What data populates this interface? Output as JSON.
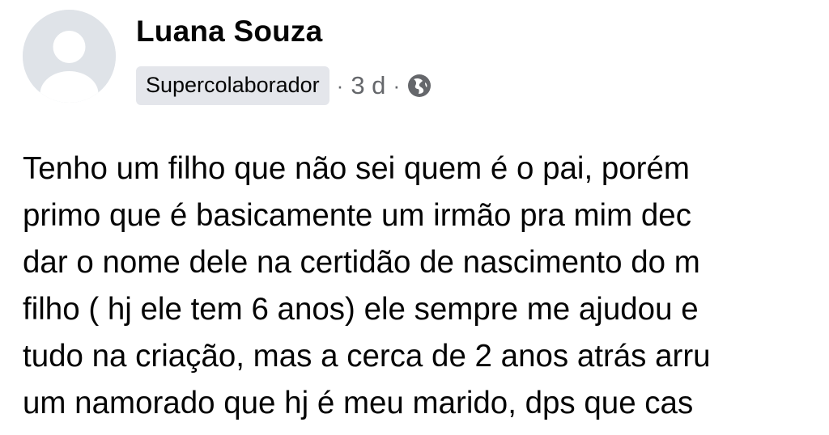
{
  "post": {
    "author": {
      "name": "Luana Souza",
      "badge": "Supercolaborador",
      "avatar_icon": "default-profile-icon"
    },
    "meta": {
      "separator": "·",
      "time": "3 d",
      "privacy_icon": "globe-icon"
    },
    "body_lines": [
      "Tenho um filho que não sei quem é o pai, porém",
      "primo que é basicamente um irmão pra mim dec",
      "dar o nome dele na certidão de nascimento do m",
      "filho ( hj ele tem 6 anos) ele sempre me ajudou e",
      "tudo na criação, mas a cerca de 2 anos atrás arru",
      "um namorado que hj é meu marido,  dps que cas"
    ]
  },
  "colors": {
    "text_primary": "#050505",
    "text_secondary": "#65676b",
    "badge_bg": "#e4e6eb",
    "avatar_bg": "#dfe3e8",
    "avatar_silhouette": "#ffffff"
  }
}
